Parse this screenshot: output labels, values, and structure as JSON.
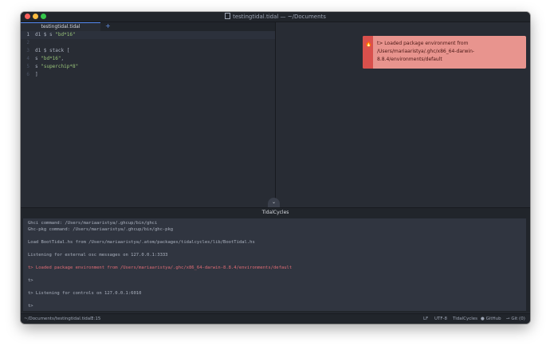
{
  "window": {
    "title": "testingtidal.tidal — ~/Documents"
  },
  "tabs": [
    {
      "label": "testingtidal.tidal"
    }
  ],
  "tab_add_label": "+",
  "editor": {
    "lines": [
      {
        "num": "1",
        "parts": [
          {
            "t": "d1 $ s ",
            "c": "plain"
          },
          {
            "t": "\"bd*16\"",
            "c": "str"
          }
        ]
      },
      {
        "num": "2",
        "parts": []
      },
      {
        "num": "3",
        "parts": [
          {
            "t": "d1 $ stack [",
            "c": "plain"
          }
        ]
      },
      {
        "num": "4",
        "parts": [
          {
            "t": "s ",
            "c": "plain"
          },
          {
            "t": "\"bd*16\"",
            "c": "str"
          },
          {
            "t": ",",
            "c": "plain"
          }
        ]
      },
      {
        "num": "5",
        "parts": [
          {
            "t": "s ",
            "c": "plain"
          },
          {
            "t": "\"superchip*8\"",
            "c": "str"
          }
        ]
      },
      {
        "num": "6",
        "parts": [
          {
            "t": "]",
            "c": "plain"
          }
        ]
      }
    ]
  },
  "notification": {
    "icon": "flame-icon",
    "lines": [
      "t> Loaded package environment from",
      "/Users/mariaaristya/.ghc/x86_64-darwin-",
      "8.8.4/environments/default"
    ]
  },
  "panel_toggle": "⌄",
  "panel": {
    "title": "TidalCycles"
  },
  "console": {
    "lines": [
      {
        "text": "Ghci command: /Users/mariaaristya/.ghcup/bin/ghci",
        "type": "normal"
      },
      {
        "text": "Ghc-pkg command: /Users/mariaaristya/.ghcup/bin/ghc-pkg",
        "type": "normal"
      },
      {
        "text": "",
        "type": "normal"
      },
      {
        "text": "Load BootTidal.hs from /Users/mariaaristya/.atom/packages/tidalcycles/lib/BootTidal.hs",
        "type": "normal"
      },
      {
        "text": "",
        "type": "normal"
      },
      {
        "text": "Listening for external osc messages on 127.0.0.1:3333",
        "type": "normal"
      },
      {
        "text": "",
        "type": "normal"
      },
      {
        "text": "t> Loaded package environment from /Users/mariaaristya/.ghc/x86_64-darwin-8.8.4/environments/default",
        "type": "error"
      },
      {
        "text": "",
        "type": "normal"
      },
      {
        "text": "t>",
        "type": "normal"
      },
      {
        "text": "",
        "type": "normal"
      },
      {
        "text": "t> Listening for controls on 127.0.0.1:6010",
        "type": "normal"
      },
      {
        "text": "",
        "type": "normal"
      },
      {
        "text": "t>",
        "type": "normal"
      }
    ]
  },
  "statusbar": {
    "path": "~/Documents/testingtidal.tidal*",
    "cursor": "1:15",
    "line_ending": "LF",
    "encoding": "UTF-8",
    "grammar": "TidalCycles",
    "github": "GitHub",
    "git": "Git (0)"
  },
  "colors": {
    "editor_bg": "#282c34",
    "string": "#98c379",
    "error": "#e06c75",
    "notification_bg": "#e8948e",
    "accent": "#568af2"
  }
}
